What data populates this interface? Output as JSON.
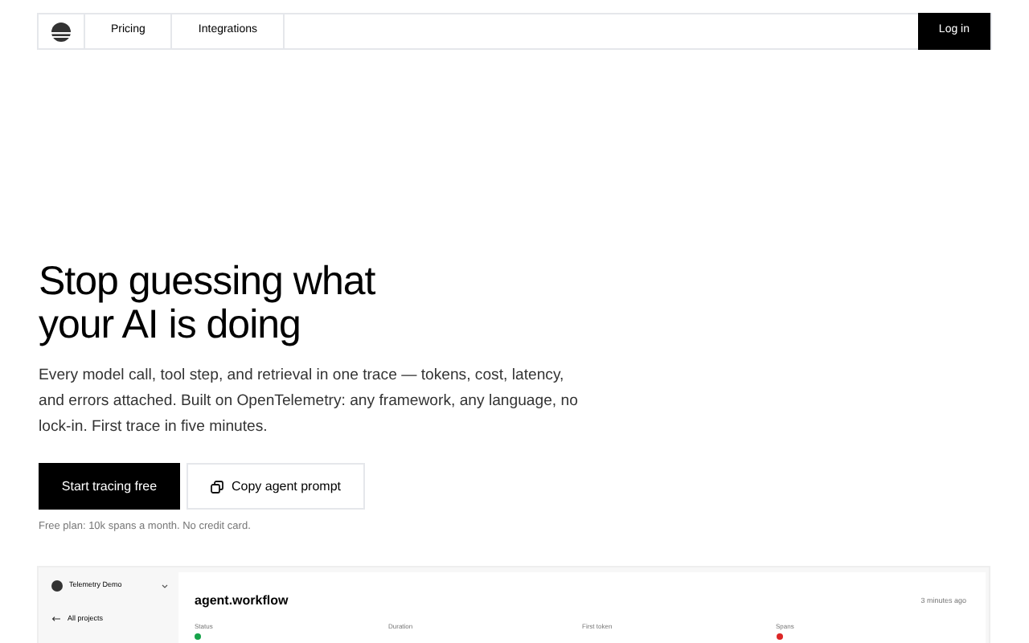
{
  "nav": {
    "links": [
      "Pricing",
      "Integrations"
    ],
    "login": "Log in"
  },
  "hero": {
    "title_lines": [
      "Stop guessing what",
      "your AI is doing"
    ],
    "body": "Every model call, tool step, and retrieval in one trace — tokens, cost, latency, and errors attached. Built on OpenTelemetry: any framework, any language, no lock-in. First trace in five minutes.",
    "primary": "Start tracing free",
    "secondary": "Copy agent prompt",
    "note": "Free plan: 10k spans a month. No credit card."
  },
  "demo": {
    "project": "Telemetry Demo",
    "back": "All projects",
    "trace": "agent.workflow",
    "time": "3 minutes ago",
    "fields": [
      {
        "label": "Status",
        "color": "#16a34a"
      },
      {
        "label": "Duration"
      },
      {
        "label": "First token"
      },
      {
        "label": "Spans",
        "color": "#dc2626"
      }
    ]
  }
}
